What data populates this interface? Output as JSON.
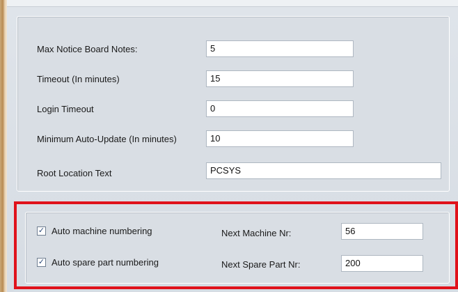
{
  "settings": {
    "max_notes_label": "Max Notice Board Notes:",
    "max_notes_value": "5",
    "timeout_label": "Timeout (In minutes)",
    "timeout_value": "15",
    "login_timeout_label": "Login Timeout",
    "login_timeout_value": "0",
    "min_auto_update_label": "Minimum Auto-Update (In minutes)",
    "min_auto_update_value": "10",
    "root_location_label": "Root Location Text",
    "root_location_value": "PCSYS"
  },
  "numbering": {
    "auto_machine_label": "Auto machine numbering",
    "auto_machine_checked": true,
    "next_machine_label": "Next Machine Nr:",
    "next_machine_value": "56",
    "auto_spare_label": "Auto spare part numbering",
    "auto_spare_checked": true,
    "next_spare_label": "Next Spare Part Nr:",
    "next_spare_value": "200",
    "check_mark": "✓"
  },
  "colors": {
    "highlight": "#e0121b"
  }
}
